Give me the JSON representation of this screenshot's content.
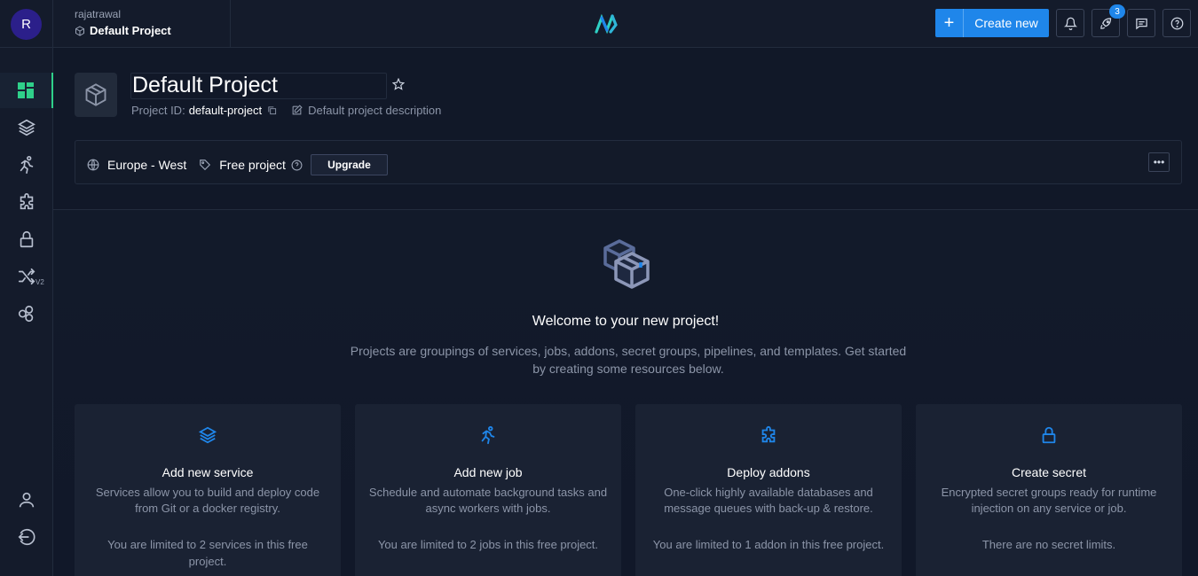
{
  "user": {
    "initial": "R",
    "name": "rajatrawal"
  },
  "breadcrumb": {
    "project": "Default Project"
  },
  "toolbar": {
    "create_label": "Create new",
    "notification_count": "3",
    "icons": [
      "bell-icon",
      "rocket-icon",
      "feedback-icon",
      "help-icon"
    ]
  },
  "sidebar": {
    "items": [
      {
        "name": "dashboard-icon",
        "active": true
      },
      {
        "name": "services-icon"
      },
      {
        "name": "jobs-icon"
      },
      {
        "name": "addons-icon"
      },
      {
        "name": "secrets-icon"
      },
      {
        "name": "pipelines-icon",
        "suffix": "V2"
      },
      {
        "name": "templates-icon"
      }
    ],
    "bottom": [
      "user-icon",
      "logout-icon"
    ]
  },
  "project": {
    "title": "Default Project",
    "id_label": "Project ID:",
    "id": "default-project",
    "description": "Default project description",
    "region": "Europe - West",
    "plan": "Free project",
    "upgrade_label": "Upgrade"
  },
  "welcome": {
    "title": "Welcome to your new project!",
    "text": "Projects are groupings of services, jobs, addons, secret groups, pipelines, and templates. Get started by creating some resources below."
  },
  "cards": [
    {
      "title": "Add new service",
      "desc": "Services allow you to build and deploy code from Git or a docker registry.",
      "limit": "You are limited to 2 services in this free project."
    },
    {
      "title": "Add new job",
      "desc": "Schedule and automate background tasks and async workers with jobs.",
      "limit": "You are limited to 2 jobs in this free project."
    },
    {
      "title": "Deploy addons",
      "desc": "One-click highly available databases and message queues with back-up & restore.",
      "limit": "You are limited to 1 addon in this free project."
    },
    {
      "title": "Create secret",
      "desc": "Encrypted secret groups ready for runtime injection on any service or job.",
      "limit": "There are no secret limits."
    }
  ],
  "colors": {
    "accent": "#1f86ea",
    "active": "#2fd08a",
    "background": "#111828"
  }
}
